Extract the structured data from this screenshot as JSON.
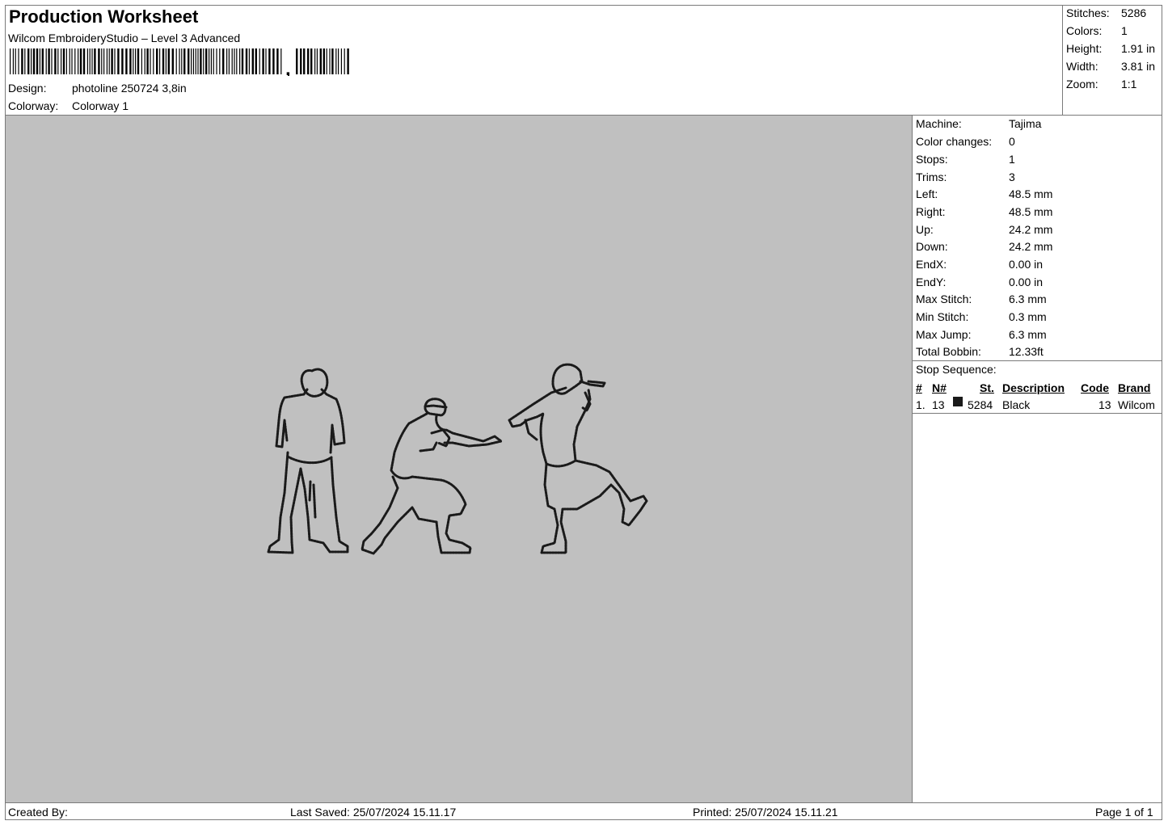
{
  "header": {
    "title": "Production Worksheet",
    "software": "Wilcom EmbroideryStudio – Level 3 Advanced",
    "design_label": "Design:",
    "design_value": "photoline  250724 3,8in",
    "colorway_label": "Colorway:",
    "colorway_value": "Colorway 1"
  },
  "summary": [
    {
      "label": "Stitches:",
      "value": "5286"
    },
    {
      "label": "Colors:",
      "value": "1"
    },
    {
      "label": "Height:",
      "value": "1.91 in"
    },
    {
      "label": "Width:",
      "value": "3.81 in"
    },
    {
      "label": "Zoom:",
      "value": "1:1"
    }
  ],
  "details": [
    {
      "label": "Machine:",
      "value": "Tajima"
    },
    {
      "label": "Color changes:",
      "value": "0"
    },
    {
      "label": "Stops:",
      "value": "1"
    },
    {
      "label": "Trims:",
      "value": "3"
    },
    {
      "label": "Left:",
      "value": "48.5 mm"
    },
    {
      "label": "Right:",
      "value": "48.5 mm"
    },
    {
      "label": "Up:",
      "value": "24.2 mm"
    },
    {
      "label": "Down:",
      "value": "24.2 mm"
    },
    {
      "label": "EndX:",
      "value": "0.00 in"
    },
    {
      "label": "EndY:",
      "value": "0.00 in"
    },
    {
      "label": "Max Stitch:",
      "value": "6.3 mm"
    },
    {
      "label": "Min Stitch:",
      "value": "0.3 mm"
    },
    {
      "label": "Max Jump:",
      "value": "6.3 mm"
    },
    {
      "label": "Total Bobbin:",
      "value": "12.33ft"
    }
  ],
  "stop_sequence": {
    "title": "Stop Sequence:",
    "headers": {
      "num": "#",
      "needle": "N#",
      "stitches": "St.",
      "description": "Description",
      "code": "Code",
      "brand": "Brand"
    },
    "rows": [
      {
        "num": "1.",
        "needle": "13",
        "color": "#1a1a1a",
        "stitches": "5284",
        "description": "Black",
        "code": "13",
        "brand": "Wilcom"
      }
    ]
  },
  "footer": {
    "created_by": "Created By:",
    "last_saved": "Last Saved: 25/07/2024 15.11.17",
    "printed": "Printed: 25/07/2024 15.11.21",
    "page": "Page 1 of 1"
  },
  "colors": {
    "canvas": "#c0c0c0",
    "thread": "#1a1a1a"
  }
}
